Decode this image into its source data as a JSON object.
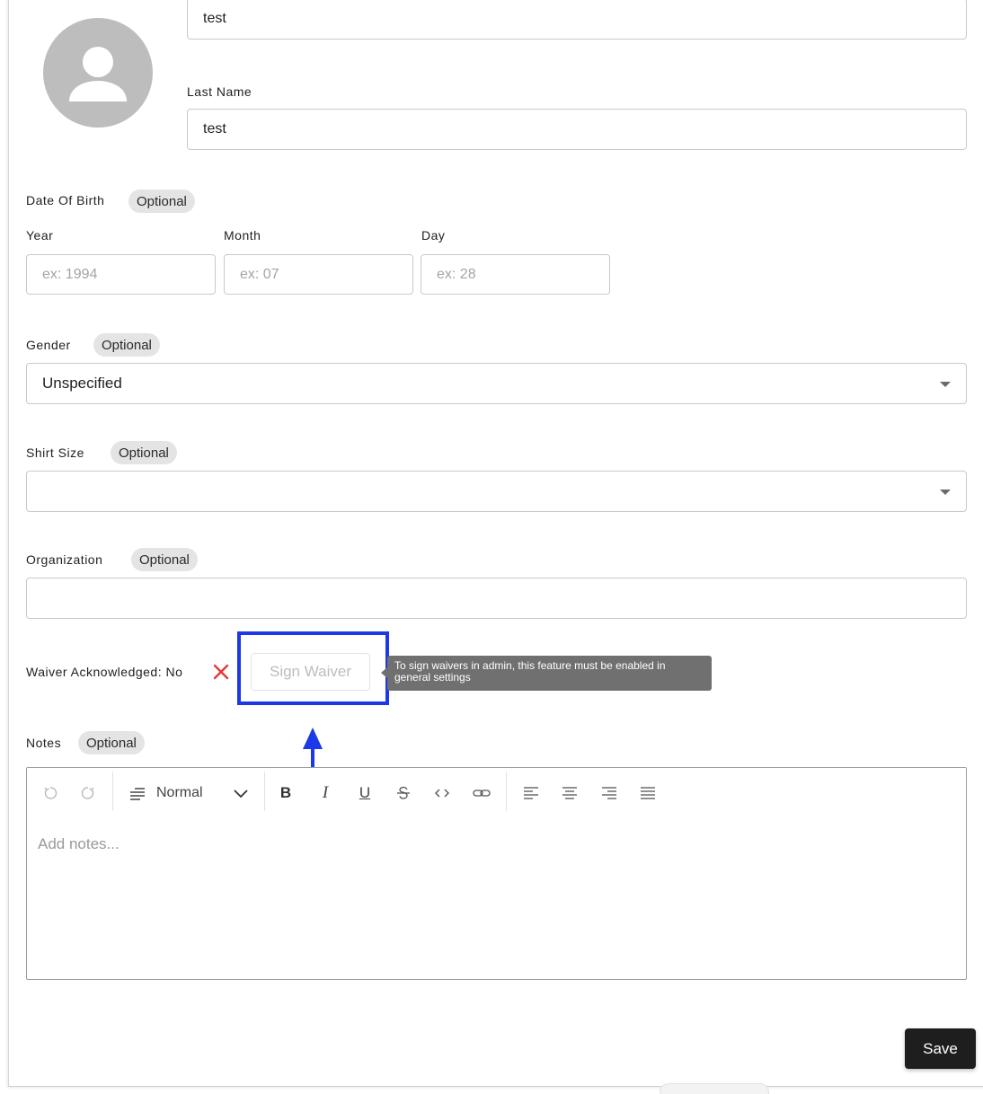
{
  "profile": {
    "first_name_value": "test",
    "last_name_label": "Last Name",
    "last_name_value": "test"
  },
  "dob": {
    "label": "Date Of Birth",
    "badge": "Optional",
    "year_label": "Year",
    "month_label": "Month",
    "day_label": "Day",
    "year_placeholder": "ex: 1994",
    "month_placeholder": "ex: 07",
    "day_placeholder": "ex: 28"
  },
  "gender": {
    "label": "Gender",
    "badge": "Optional",
    "selected": "Unspecified"
  },
  "shirt_size": {
    "label": "Shirt Size",
    "badge": "Optional",
    "selected": ""
  },
  "organization": {
    "label": "Organization",
    "badge": "Optional",
    "value": ""
  },
  "waiver": {
    "label": "Waiver Acknowledged: No",
    "button_label": "Sign Waiver",
    "tooltip_line1": "To sign waivers in admin, this feature must be enabled in",
    "tooltip_line2": "general settings",
    "status_icon": "x-mark-icon",
    "status_color": "#e53935"
  },
  "notes": {
    "label": "Notes",
    "badge": "Optional",
    "format_label": "Normal",
    "placeholder": "Add notes..."
  },
  "toolbar_icons": [
    "undo-icon",
    "redo-icon",
    "paragraph-icon",
    "bold-icon",
    "italic-icon",
    "underline-icon",
    "strikethrough-icon",
    "code-icon",
    "link-icon",
    "align-left-icon",
    "align-center-icon",
    "align-right-icon",
    "align-justify-icon"
  ],
  "actions": {
    "save_label": "Save"
  },
  "colors": {
    "highlight": "#1d38e6",
    "save_bg": "#1e1e1e",
    "avatar_bg": "#bdbdbd"
  }
}
